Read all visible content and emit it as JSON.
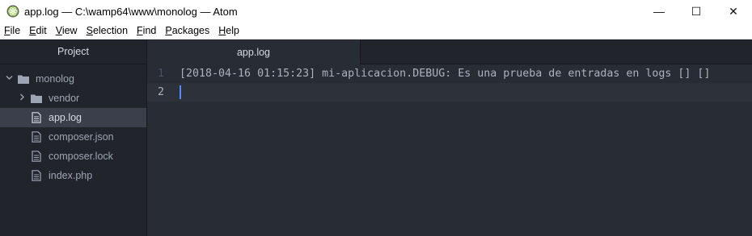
{
  "window": {
    "title": "app.log — C:\\wamp64\\www\\monolog — Atom",
    "controls": {
      "minimize": "—",
      "maximize": "☐",
      "close": "✕"
    }
  },
  "menu": [
    {
      "u": "F",
      "rest": "ile"
    },
    {
      "u": "E",
      "rest": "dit"
    },
    {
      "u": "V",
      "rest": "iew"
    },
    {
      "u": "S",
      "rest": "election"
    },
    {
      "u": "F",
      "rest": "ind"
    },
    {
      "u": "P",
      "rest": "ackages"
    },
    {
      "u": "H",
      "rest": "elp"
    }
  ],
  "tree": {
    "header": "Project",
    "root": {
      "label": "monolog",
      "icon": "folder-icon",
      "expanded": true
    },
    "items": [
      {
        "label": "vendor",
        "icon": "folder-icon",
        "type": "folder",
        "expanded": false
      },
      {
        "label": "app.log",
        "icon": "file-icon",
        "type": "file",
        "selected": true
      },
      {
        "label": "composer.json",
        "icon": "file-icon",
        "type": "file"
      },
      {
        "label": "composer.lock",
        "icon": "file-icon",
        "type": "file"
      },
      {
        "label": "index.php",
        "icon": "file-icon",
        "type": "file"
      }
    ]
  },
  "tabs": [
    {
      "label": "app.log",
      "active": true
    }
  ],
  "editor": {
    "lines": [
      {
        "number": "1",
        "text": "[2018-04-16 01:15:23] mi-aplicacion.DEBUG: Es una prueba de entradas en logs [] []"
      },
      {
        "number": "2",
        "text": ""
      }
    ]
  },
  "colors": {
    "accent": "#528bff",
    "background": "#282c34",
    "panel": "#21252b"
  }
}
